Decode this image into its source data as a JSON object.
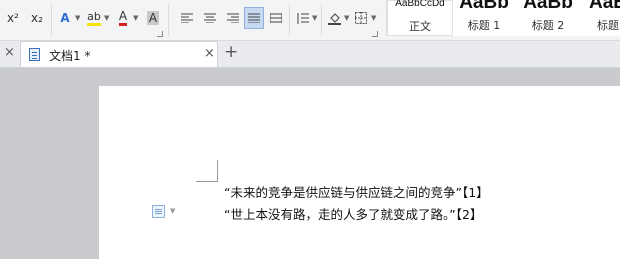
{
  "ribbon": {
    "superscript_label": "x²",
    "subscript_label": "x₂",
    "text_effect_glyph": "A",
    "highlight_glyph": "ab",
    "font_color_glyph": "A",
    "char_shading_glyph": "A",
    "colors": {
      "highlight": "#f5e30a",
      "font_color": "#d62222",
      "text_effect": "#2e6fd1"
    }
  },
  "styles": [
    {
      "sample": "AaBbCcDd",
      "name": "正文"
    },
    {
      "sample": "AaBb",
      "name": "标题 1"
    },
    {
      "sample": "AaBb",
      "name": "标题 2"
    },
    {
      "sample": "AaB",
      "name": "标题"
    }
  ],
  "tabs": {
    "close_all": "×",
    "document": {
      "title": "文档1 *",
      "close": "×"
    },
    "new_tab": "+"
  },
  "document": {
    "lines": [
      "“未来的竞争是供应链与供应链之间的竞争”【1】",
      "“世上本没有路，走的人多了就变成了路。”【2】"
    ]
  }
}
